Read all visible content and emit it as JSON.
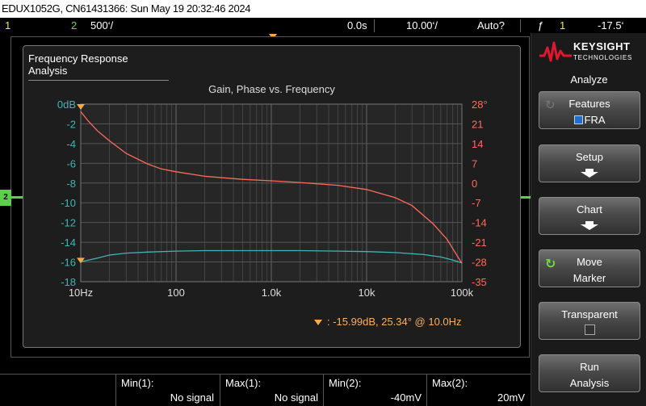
{
  "title_bar": "EDUX1052G, CN61431366: Sun May 19 20:32:46 2024",
  "status": {
    "ch1_num": "1",
    "ch2_num": "2",
    "ch2_scale": "500‘/",
    "time_delay": "0.0s",
    "time_scale": "10.00‘/",
    "trigger_mode": "Auto?",
    "trigger_icon": "ƒ",
    "trigger_source": "1",
    "trigger_level": "-17.5‘"
  },
  "ch2_marker": "2",
  "fra": {
    "window_title": "Frequency Response Analysis",
    "chart_title": "Gain, Phase vs. Frequency",
    "marker_readout": ": -15.99dB, 25.34° @ 10.0Hz"
  },
  "chart_data": {
    "type": "line",
    "title": "Gain, Phase vs. Frequency",
    "xscale": "log",
    "xlim": [
      10,
      100000
    ],
    "x_ticks": [
      "10Hz",
      "100",
      "1.0k",
      "10k",
      "100k"
    ],
    "y_left_ticks": [
      "0dB",
      "-2",
      "-4",
      "-6",
      "-8",
      "-10",
      "-12",
      "-14",
      "-16",
      "-18"
    ],
    "y_left_lim": [
      -18,
      0
    ],
    "y_right_ticks": [
      "28°",
      "21",
      "14",
      "7",
      "0",
      "-7",
      "-14",
      "-21",
      "-28",
      "-35"
    ],
    "y_right_lim": [
      -35,
      28
    ],
    "grid": true,
    "colors": {
      "gain": "#3fb6b6",
      "phase": "#ff6a5a",
      "axis": "#3fb6b6"
    },
    "series": [
      {
        "axis": "left",
        "unit": "dB",
        "x": [
          10,
          15,
          20,
          30,
          50,
          100,
          200,
          500,
          1000,
          2000,
          5000,
          10000,
          20000,
          40000,
          60000,
          80000,
          100000
        ],
        "values": [
          -15.99,
          -15.6,
          -15.3,
          -15.1,
          -15.0,
          -14.9,
          -14.85,
          -14.85,
          -14.85,
          -14.85,
          -14.9,
          -14.95,
          -15.05,
          -15.25,
          -15.5,
          -15.8,
          -16.1
        ]
      },
      {
        "axis": "right",
        "unit": "deg",
        "x": [
          10,
          12,
          15,
          20,
          30,
          50,
          70,
          100,
          200,
          500,
          1000,
          2000,
          5000,
          10000,
          20000,
          30000,
          50000,
          70000,
          100000
        ],
        "values": [
          25.34,
          22,
          18.5,
          15,
          10.5,
          6.8,
          5,
          4,
          2.4,
          1.3,
          0.8,
          0.2,
          -0.8,
          -2.3,
          -5.2,
          -8,
          -14.5,
          -20,
          -28.5
        ]
      }
    ],
    "marker": {
      "frequency_hz": 10.0,
      "gain_db": -15.99,
      "phase_deg": 25.34
    }
  },
  "softkeys": {
    "brand": "KEYSIGHT",
    "brand_sub": "TECHNOLOGIES",
    "menu_title": "Analyze",
    "features_label": "Features",
    "features_value": "FRA",
    "setup_label": "Setup",
    "chart_label": "Chart",
    "move_label": "Move",
    "move_label2": "Marker",
    "transparent_label": "Transparent",
    "run_label": "Run",
    "run_label2": "Analysis"
  },
  "measurements": [
    {
      "label": "Min(1):",
      "value": "No signal"
    },
    {
      "label": "Max(1):",
      "value": "No signal"
    },
    {
      "label": "Min(2):",
      "value": "-40mV"
    },
    {
      "label": "Max(2):",
      "value": "20mV"
    }
  ]
}
